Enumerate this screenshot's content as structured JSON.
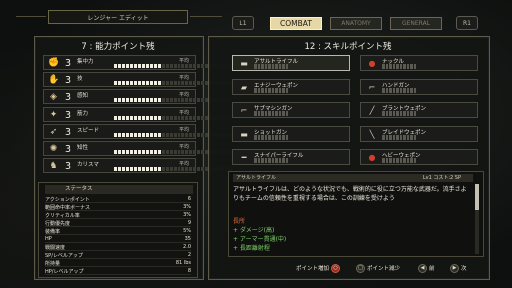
{
  "window": {
    "title": "レンジャー エディット"
  },
  "tabs": {
    "left_shoulder": "L1",
    "right_shoulder": "R1",
    "items": [
      {
        "label": "COMBAT",
        "active": true
      },
      {
        "label": "ANATOMY",
        "active": false
      },
      {
        "label": "GENERAL",
        "active": false
      }
    ]
  },
  "attributes": {
    "header": "7 : 能力ポイント残",
    "rows": [
      {
        "icon": "strength-icon",
        "level": "3",
        "name": "集中力",
        "rank": "平均",
        "segments_on": 12,
        "segments_total": 30
      },
      {
        "icon": "perception-icon",
        "level": "3",
        "name": "技",
        "rank": "平均",
        "segments_on": 12,
        "segments_total": 30
      },
      {
        "icon": "agility-icon",
        "level": "3",
        "name": "感知",
        "rank": "平均",
        "segments_on": 12,
        "segments_total": 30
      },
      {
        "icon": "strength-arm-icon",
        "level": "3",
        "name": "筋力",
        "rank": "平均",
        "segments_on": 12,
        "segments_total": 30
      },
      {
        "icon": "speed-icon",
        "level": "3",
        "name": "スピード",
        "rank": "平均",
        "segments_on": 12,
        "segments_total": 30
      },
      {
        "icon": "intelligence-icon",
        "level": "3",
        "name": "知性",
        "rank": "平均",
        "segments_on": 12,
        "segments_total": 30
      },
      {
        "icon": "charisma-icon",
        "level": "3",
        "name": "カリスマ",
        "rank": "平均",
        "segments_on": 12,
        "segments_total": 30
      }
    ]
  },
  "stats": {
    "header": "ステータス",
    "lines": [
      {
        "label": "アクションポイント",
        "value": "6"
      },
      {
        "label": "範囲命中率ボーナス",
        "value": "3%"
      },
      {
        "label": "クリティカル率",
        "value": "3%"
      },
      {
        "label": "行動優先度",
        "value": "9"
      },
      {
        "label": "装備率",
        "value": "5%"
      },
      {
        "label": "HP",
        "value": "35"
      },
      {
        "label": "戦闘速度",
        "value": "2.0"
      },
      {
        "label": "SP/レベルアップ",
        "value": "2"
      },
      {
        "label": "所持量",
        "value": "81 lbs"
      },
      {
        "label": "HP/レベルアップ",
        "value": "8"
      }
    ]
  },
  "skills": {
    "header": "12 : スキルポイント残",
    "items": [
      {
        "name": "アサルトライフル",
        "icon": "rifle-icon",
        "pips_on": 0,
        "selected": true
      },
      {
        "name": "ナックル",
        "icon": "knuckle-icon",
        "pips_on": 0,
        "selected": false
      },
      {
        "name": "エナジーウェポン",
        "icon": "energy-weapon-icon",
        "pips_on": 0,
        "selected": false
      },
      {
        "name": "ハンドガン",
        "icon": "handgun-icon",
        "pips_on": 0,
        "selected": false
      },
      {
        "name": "サブマシンガン",
        "icon": "smg-icon",
        "pips_on": 0,
        "selected": false
      },
      {
        "name": "ブラントウェポン",
        "icon": "blunt-weapon-icon",
        "pips_on": 0,
        "selected": false
      },
      {
        "name": "ショットガン",
        "icon": "shotgun-icon",
        "pips_on": 0,
        "selected": false
      },
      {
        "name": "ブレイドウェポン",
        "icon": "blade-weapon-icon",
        "pips_on": 0,
        "selected": false
      },
      {
        "name": "スナイパーライフル",
        "icon": "sniper-rifle-icon",
        "pips_on": 0,
        "selected": false
      },
      {
        "name": "ヘビーウェポン",
        "icon": "heavy-weapon-icon",
        "pips_on": 0,
        "selected": false
      }
    ]
  },
  "description": {
    "title": "アサルトライフル",
    "meta": "Lv1 コスト:2 SP",
    "text": "アサルトライフルは、どのような状況でも、戦術的に役に立つ万能な武器だ。流手さよりもチームの信頼性を重視する場合は、この訓練を受けよう",
    "merits_title": "長所",
    "merits": [
      "+ ダメージ(高)",
      "+ アーマー貫通(中)",
      "+ 長距離射程"
    ]
  },
  "footer": {
    "add": "ポイント増加",
    "remove": "ポイント減少",
    "prev": "前",
    "next": "次"
  }
}
